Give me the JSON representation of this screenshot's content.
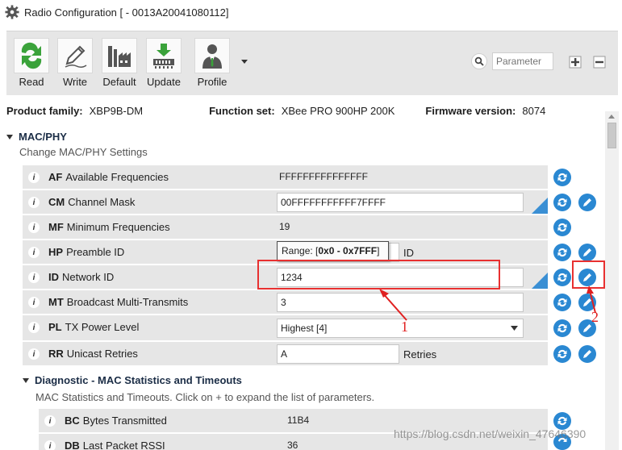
{
  "window": {
    "title": "Radio Configuration [  - 0013A20041080112]"
  },
  "toolbar": {
    "buttons": [
      {
        "label": "Read",
        "icon": "read-icon"
      },
      {
        "label": "Write",
        "icon": "write-icon"
      },
      {
        "label": "Default",
        "icon": "factory-icon"
      },
      {
        "label": "Update",
        "icon": "update-icon"
      },
      {
        "label": "Profile",
        "icon": "profile-icon"
      }
    ],
    "search_placeholder": "Parameter"
  },
  "info": {
    "product_family_label": "Product family:",
    "product_family": "XBP9B-DM",
    "function_set_label": "Function set:",
    "function_set": "XBee PRO 900HP 200K",
    "firmware_label": "Firmware version:",
    "firmware": "8074"
  },
  "section": {
    "title": "MAC/PHY",
    "description": "Change MAC/PHY Settings"
  },
  "params": [
    {
      "code": "AF",
      "name": "Available Frequencies",
      "value": "FFFFFFFFFFFFFFF"
    },
    {
      "code": "CM",
      "name": "Channel Mask",
      "value": "00FFFFFFFFFFF7FFFF"
    },
    {
      "code": "MF",
      "name": "Minimum Frequencies",
      "value": "19"
    },
    {
      "code": "HP",
      "name": "Preamble ID",
      "value": "",
      "unit": "ID"
    },
    {
      "code": "ID",
      "name": "Network ID",
      "value": "1234"
    },
    {
      "code": "MT",
      "name": "Broadcast Multi-Transmits",
      "value": "3"
    },
    {
      "code": "PL",
      "name": "TX Power Level",
      "value": "Highest [4]"
    },
    {
      "code": "RR",
      "name": "Unicast Retries",
      "value": "A",
      "unit": "Retries"
    }
  ],
  "tooltip": {
    "prefix": "Range: [",
    "range": "0x0 - 0x7FFF",
    "suffix": "]"
  },
  "subsection": {
    "title": "Diagnostic - MAC Statistics and Timeouts",
    "description": "MAC Statistics and Timeouts. Click on + to expand the list of parameters."
  },
  "sub_params": [
    {
      "code": "BC",
      "name": "Bytes Transmitted",
      "value": "11B4"
    },
    {
      "code": "DB",
      "name": "Last Packet RSSI",
      "value": "36"
    }
  ],
  "annotations": {
    "one": "1",
    "two": "2"
  },
  "watermark": "https://blog.csdn.net/weixin_47646390",
  "colors": {
    "accent": "#2a88d2",
    "annotation": "#e83030",
    "row_bg": "#e6e6e6"
  }
}
